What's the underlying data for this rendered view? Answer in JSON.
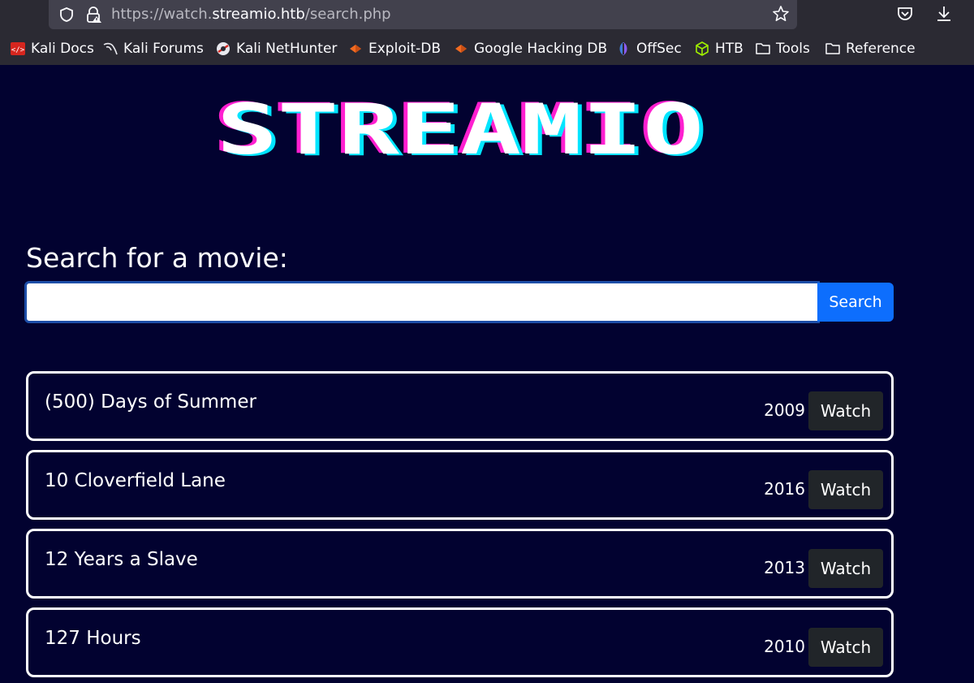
{
  "browser": {
    "url_prefix": "https://watch.",
    "url_domain": "streamio.htb",
    "url_path": "/search.php",
    "bookmarks": [
      {
        "label": "Kali Docs",
        "icon": "kali-docs-icon"
      },
      {
        "label": "Kali Forums",
        "icon": "kali-dragon-icon"
      },
      {
        "label": "Kali NetHunter",
        "icon": "nethunter-icon"
      },
      {
        "label": "Exploit-DB",
        "icon": "exploit-db-icon"
      },
      {
        "label": "Google Hacking DB",
        "icon": "ghdb-icon"
      },
      {
        "label": "OffSec",
        "icon": "offsec-icon"
      },
      {
        "label": "HTB",
        "icon": "htb-cube-icon"
      },
      {
        "label": "Tools",
        "icon": "folder-icon"
      },
      {
        "label": "Reference",
        "icon": "folder-icon"
      }
    ]
  },
  "page": {
    "logo_text": "STREAMIO",
    "search_heading": "Search for a movie:",
    "search_value": "",
    "search_placeholder": "",
    "search_button": "Search",
    "movies": [
      {
        "title": "(500) Days of Summer",
        "year": "2009",
        "action": "Watch"
      },
      {
        "title": "10 Cloverfield Lane",
        "year": "2016",
        "action": "Watch"
      },
      {
        "title": "12 Years a Slave",
        "year": "2013",
        "action": "Watch"
      },
      {
        "title": "127 Hours",
        "year": "2010",
        "action": "Watch"
      }
    ]
  },
  "colors": {
    "page_background": "#020230",
    "search_button": "#0d6efd",
    "watch_button": "#212529",
    "logo_cyan": "#00e5ff",
    "logo_magenta": "#ff1fd0"
  }
}
